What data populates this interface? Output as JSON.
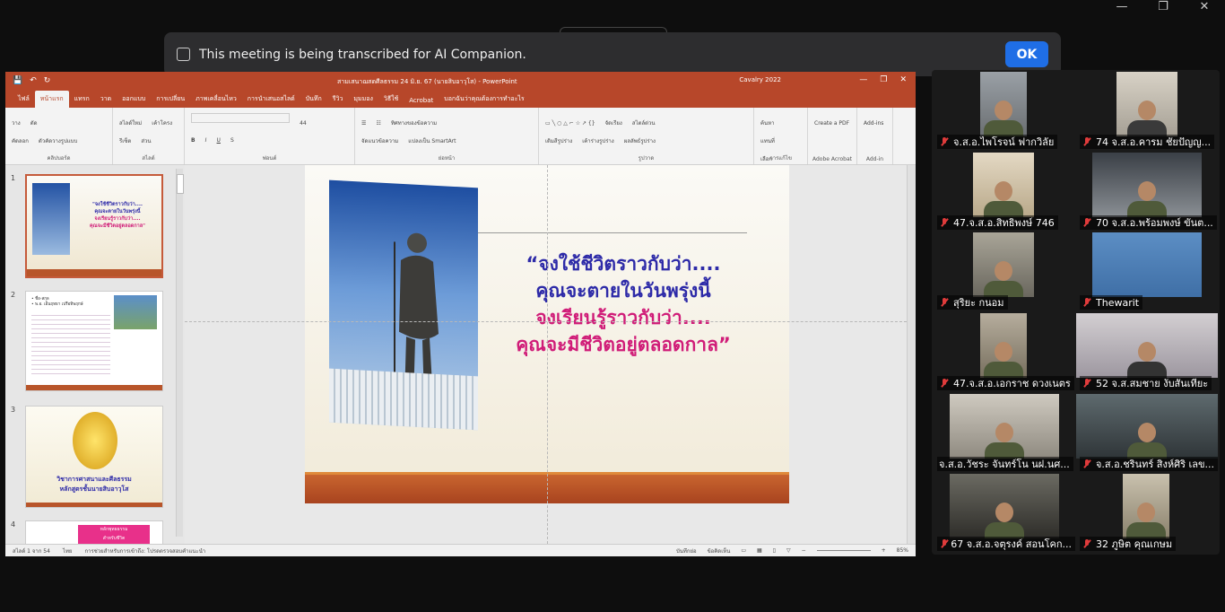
{
  "banner": {
    "text": "This meeting is being transcribed for AI Companion.",
    "ok_label": "OK"
  },
  "ppt": {
    "doc_title": "สามเสนาฌสดศีลธรรม 24 มิ.ย. 67 (นายสิบอาวุโส)  -  PowerPoint",
    "user_name": "Cavalry 2022",
    "tabs": [
      "ไฟล์",
      "หน้าแรก",
      "แทรก",
      "วาด",
      "ออกแบบ",
      "การเปลี่ยน",
      "ภาพเคลื่อนไหว",
      "การนำเสนอสไลด์",
      "บันทึก",
      "รีวิว",
      "มุมมอง",
      "วิธีใช้",
      "Acrobat",
      "บอกฉันว่าคุณต้องการทำอะไร"
    ],
    "ribbon_groups": [
      "คลิปบอร์ด",
      "สไลด์",
      "ฟอนต์",
      "ย่อหน้า",
      "รูปวาด",
      "การแก้ไข",
      "Adobe Acrobat",
      "Add-in"
    ],
    "ribbon_buttons": {
      "paste": "วาง",
      "cut": "ตัด",
      "copy": "คัดลอก",
      "format_painter": "ตัวคัดวางรูปแบบ",
      "new_slide": "สไลด์ใหม่",
      "layout": "เค้าโครง",
      "reset": "รีเซ็ต",
      "section": "ส่วน",
      "font_size": "44",
      "arrange": "จัดเรียง",
      "quick_styles": "สไตล์ด่วน",
      "shape_fill": "เติมสีรูปร่าง",
      "shape_outline": "เค้าร่างรูปร่าง",
      "shape_effects": "ผลลัพธ์รูปร่าง",
      "find": "ค้นหา",
      "replace": "แทนที่",
      "select": "เลือก",
      "create_pdf": "Create a PDF",
      "addins": "Add-ins",
      "text_direction": "ทิศทางของข้อความ",
      "align_text": "จัดแนวข้อความ",
      "smartart": "แปลงเป็น SmartArt"
    },
    "slide_quote": [
      "“จงใช้ชีวิตราวกับว่า....",
      "คุณจะตายในวันพรุ่งนี้",
      "จงเรียนรู้ราวกับว่า....",
      "คุณจะมีชีวิตอยู่ตลอดกาล”"
    ],
    "thumbs": [
      {
        "num": "1",
        "lines": [
          "\"จงใช้ชีวิตราวกับว่า....",
          "คุณจะตายในวันพรุ่งนี้",
          "จงเรียนรู้ราวกับว่า....",
          "คุณจะมีชีวิตอยู่ตลอดกาล\""
        ]
      },
      {
        "num": "2",
        "lines": [
          "• ชื่อ-สกุล",
          "• พ.อ. เอ็นฤทธา เปรือทิพฤกษ์"
        ]
      },
      {
        "num": "3",
        "lines": [
          "วิชาการศาสนาและศีลธรรม",
          "หลักสูตรชั้นนายสิบอาวุโส"
        ]
      },
      {
        "num": "4",
        "lines": [
          "หลักพุทธธรรม",
          "สำหรับชีวิต"
        ]
      }
    ],
    "status": {
      "slide_of": "สไลด์ 1 จาก 54",
      "lang": "ไทย",
      "accessibility": "การช่วยสำหรับการเข้าถึง: โปรดตรวจสอบคำแนะนำ",
      "notes": "บันทึกย่อ",
      "comments": "ข้อคิดเห็น",
      "zoom": "85%"
    }
  },
  "gallery": [
    {
      "name": "จ.ส.อ.ไพโรจน์ ฟากวิลัย",
      "muted": true
    },
    {
      "name": "74 จ.ส.อ.คารม ชัยปัญญ...",
      "muted": true
    },
    {
      "name": "47.จ.ส.อ.สิทธิพงษ์ 746",
      "muted": true
    },
    {
      "name": "70 จ.ส.อ.พร้อมพงษ์ ขันต...",
      "muted": true
    },
    {
      "name": "สุริยะ กนอม",
      "muted": true
    },
    {
      "name": "Thewarit",
      "muted": true
    },
    {
      "name": "47.จ.ส.อ.เอกราช ดวงเนตร",
      "muted": true
    },
    {
      "name": "52 จ.ส.สมชาย  งับสันเทียะ",
      "muted": true
    },
    {
      "name": "จ.ส.อ.วัชระ จันทร์โน นฝ.นศ...",
      "muted": false
    },
    {
      "name": "จ.ส.อ.ชรินทร์ สิงห์ศิริ เลข...",
      "muted": true
    },
    {
      "name": "67 จ.ส.อ.จตุรงค์ สอนโคก...",
      "muted": true
    },
    {
      "name": "32 ภูษิต คุณเกษม",
      "muted": true
    }
  ]
}
